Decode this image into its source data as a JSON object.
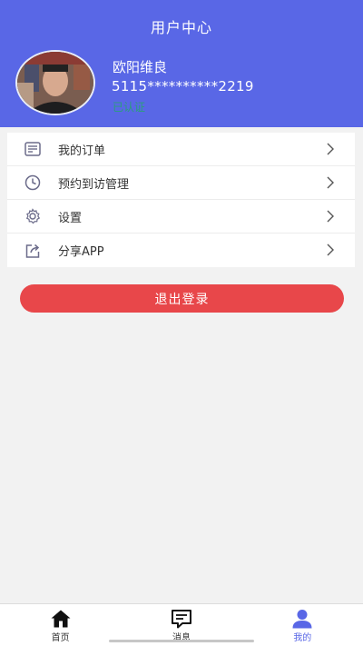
{
  "header": {
    "title": "用户中心",
    "background_color": "#5967e6"
  },
  "user": {
    "name": "欧阳维良",
    "id_masked": "5115**********2219",
    "status": "已认证",
    "status_color": "#2a9f7a"
  },
  "menu": {
    "items": [
      {
        "label": "我的订单",
        "icon": "order-list-icon"
      },
      {
        "label": "预约到访管理",
        "icon": "clock-icon"
      },
      {
        "label": "设置",
        "icon": "gear-icon"
      },
      {
        "label": "分享APP",
        "icon": "share-icon"
      }
    ]
  },
  "logout": {
    "label": "退出登录",
    "color": "#e8474a"
  },
  "tabbar": {
    "tabs": [
      {
        "label": "首页",
        "icon": "home-icon",
        "active": false
      },
      {
        "label": "消息",
        "icon": "message-icon",
        "active": false
      },
      {
        "label": "我的",
        "icon": "profile-icon",
        "active": true
      }
    ],
    "active_color": "#5967e6"
  }
}
